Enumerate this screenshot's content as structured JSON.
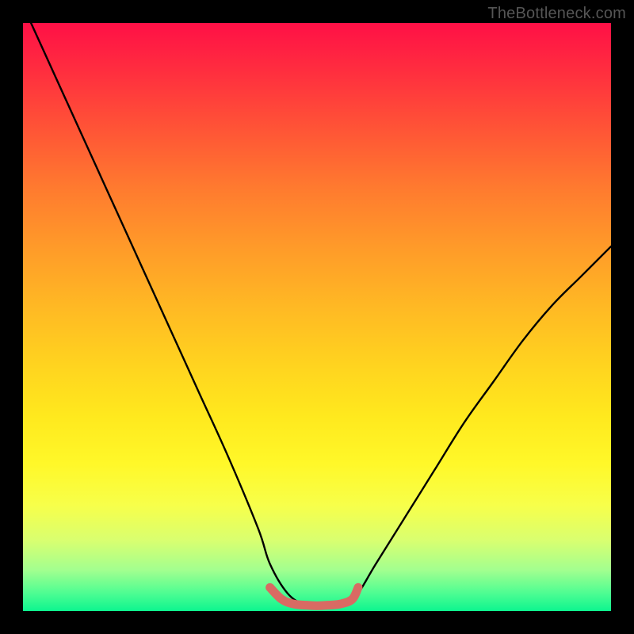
{
  "watermark": "TheBottleneck.com",
  "chart_data": {
    "type": "line",
    "title": "",
    "xlabel": "",
    "ylabel": "",
    "xlim": [
      0,
      100
    ],
    "ylim": [
      0,
      100
    ],
    "series": [
      {
        "name": "bottleneck-curve",
        "x": [
          0,
          5,
          10,
          15,
          20,
          25,
          30,
          35,
          40,
          42,
          45,
          48,
          50,
          52,
          55,
          57,
          60,
          65,
          70,
          75,
          80,
          85,
          90,
          95,
          100
        ],
        "y": [
          103,
          92,
          81,
          70,
          59,
          48,
          37,
          26,
          14,
          8,
          3,
          1,
          0.8,
          0.8,
          1,
          3,
          8,
          16,
          24,
          32,
          39,
          46,
          52,
          57,
          62
        ]
      },
      {
        "name": "optimal-zone-marker",
        "x": [
          42,
          44,
          46,
          48,
          50,
          52,
          54,
          56,
          57
        ],
        "y": [
          4,
          2,
          1.2,
          1,
          0.9,
          1,
          1.2,
          2,
          4
        ]
      }
    ],
    "colors": {
      "curve": "#000000",
      "marker": "#d96a63",
      "gradient_top": "#ff1046",
      "gradient_bottom": "#0df58f"
    }
  }
}
